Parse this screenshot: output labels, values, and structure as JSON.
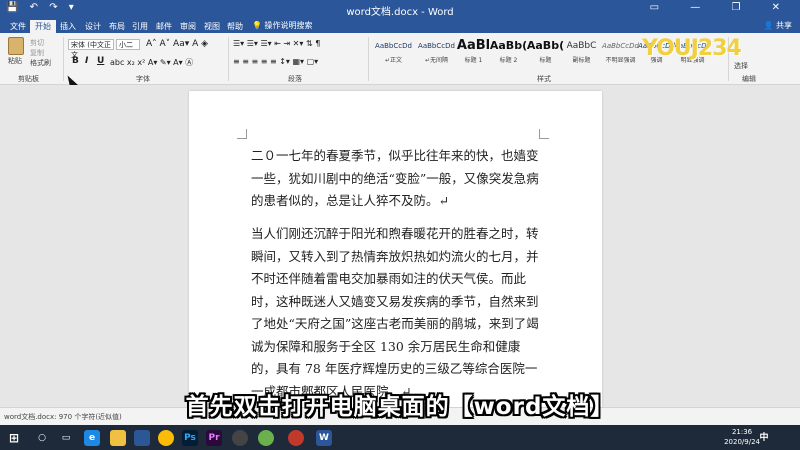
{
  "titlebar": {
    "title": "word文档.docx - Word",
    "quick_access": "💾 ↶ ↷ ▾",
    "window_controls": "▭ — ❐ ✕"
  },
  "tabs": [
    {
      "label": "文件"
    },
    {
      "label": "开始"
    },
    {
      "label": "插入"
    },
    {
      "label": "设计"
    },
    {
      "label": "布局"
    },
    {
      "label": "引用"
    },
    {
      "label": "邮件"
    },
    {
      "label": "审阅"
    },
    {
      "label": "视图"
    },
    {
      "label": "帮助"
    }
  ],
  "tell_me": "💡 操作说明搜索",
  "share": "👤 共享",
  "ribbon": {
    "clipboard": {
      "paste": "粘贴",
      "cut": "剪切",
      "copy": "复制",
      "format_painter": "格式刷",
      "group": "剪贴板"
    },
    "font": {
      "name": "宋体 (中文正文",
      "size": "小二",
      "group": "字体",
      "bold": "B",
      "italic": "I",
      "underline": "U"
    },
    "paragraph": {
      "group": "段落"
    },
    "styles": {
      "group": "样式",
      "items": [
        {
          "sample": "AaBbCcDd",
          "name": "↵正文"
        },
        {
          "sample": "AaBbCcDd",
          "name": "↵无间隔"
        },
        {
          "sample": "AaBl",
          "name": "标题 1"
        },
        {
          "sample": "AaBb(",
          "name": "标题 2"
        },
        {
          "sample": "AaBb(",
          "name": "标题"
        },
        {
          "sample": "AaBbC",
          "name": "副标题"
        },
        {
          "sample": "AaBbCcDd",
          "name": "不明显强调"
        },
        {
          "sample": "AaBbCcDd",
          "name": "强调"
        },
        {
          "sample": "AaBbCcDd",
          "name": "明显强调"
        }
      ]
    },
    "editing": {
      "select": "选择",
      "group": "编辑"
    }
  },
  "logo_text": "YOUJ234",
  "document": {
    "paragraphs": [
      "二０一七年的春夏季节，似乎比往年来的快，也嫱变一些，犹如川剧中的绝活“变脸”一般，又像突发急病的患者似的，总是让人猝不及防。↵",
      "当人们刚还沉醉于阳光和煦春暖花开的胜春之时，转瞬间，又转入到了热情奔放炽热如灼流火的七月，并不时还伴随着雷电交加暴雨如注的伏天气侯。而此时，这种既迷人又嫱变又易发疾病的季节，自然来到了地处“天府之国”这座古老而美丽的鹃城，来到了竭诚为保障和服务于全区 130 余万居民生命和健康的，具有 78 年医疗辉煌历史的三级乙等综合医院一一成都市郫都区人民医院。↵"
    ]
  },
  "statusbar": {
    "text": "word文档.docx: 970 个字符(近似值)"
  },
  "taskbar": {
    "time": "21:36",
    "date": "2020/9/24",
    "lang": "中"
  },
  "subtitle": "首先双击打开电脑桌面的【word文档】"
}
